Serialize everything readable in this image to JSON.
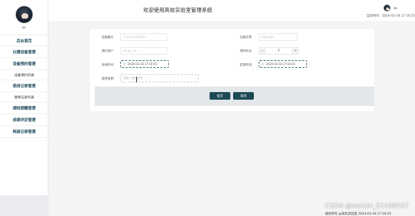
{
  "sidebar": {
    "username": "aa",
    "items": [
      {
        "label": "后台首页",
        "sub": false
      },
      {
        "label": "仪器设备管理",
        "sub": false
      },
      {
        "label": "设备预约管理",
        "sub": false
      },
      {
        "label": "设备预约列表",
        "sub": true
      },
      {
        "label": "使用记录管理",
        "sub": false
      },
      {
        "label": "使用记录列表",
        "sub": true
      },
      {
        "label": "通知提醒管理",
        "sub": false
      },
      {
        "label": "成绩评定管理",
        "sub": false
      },
      {
        "label": "耗损记录管理",
        "sub": false
      }
    ]
  },
  "header": {
    "title": "欢迎使用高校实验室管理系统",
    "username": "aa",
    "time_label": "当前时间：2024-03-18 17:16:55"
  },
  "form": {
    "device_id_label": "设备编号",
    "device_id_value": "1710761826673",
    "device_name_label": "设备名称",
    "device_name_value": "设备名称5",
    "user_label": "预约用户",
    "user_value": "aa 张三33",
    "duration_label": "预约时长",
    "duration_value": "2",
    "start_label": "开始时间",
    "start_value": "2024-03-18 17:16:55",
    "end_label": "结束时间",
    "end_value": "2024-03-18 17:16:55",
    "purpose_label": "使用说明",
    "purpose_placeholder": "请输入使用说明",
    "submit_label": "提交",
    "cancel_label": "取消"
  },
  "watermark": "CSDN @weixin_61498557",
  "footer_text": "版权所有 @高校实验室 2024-03-18 17:16:55"
}
